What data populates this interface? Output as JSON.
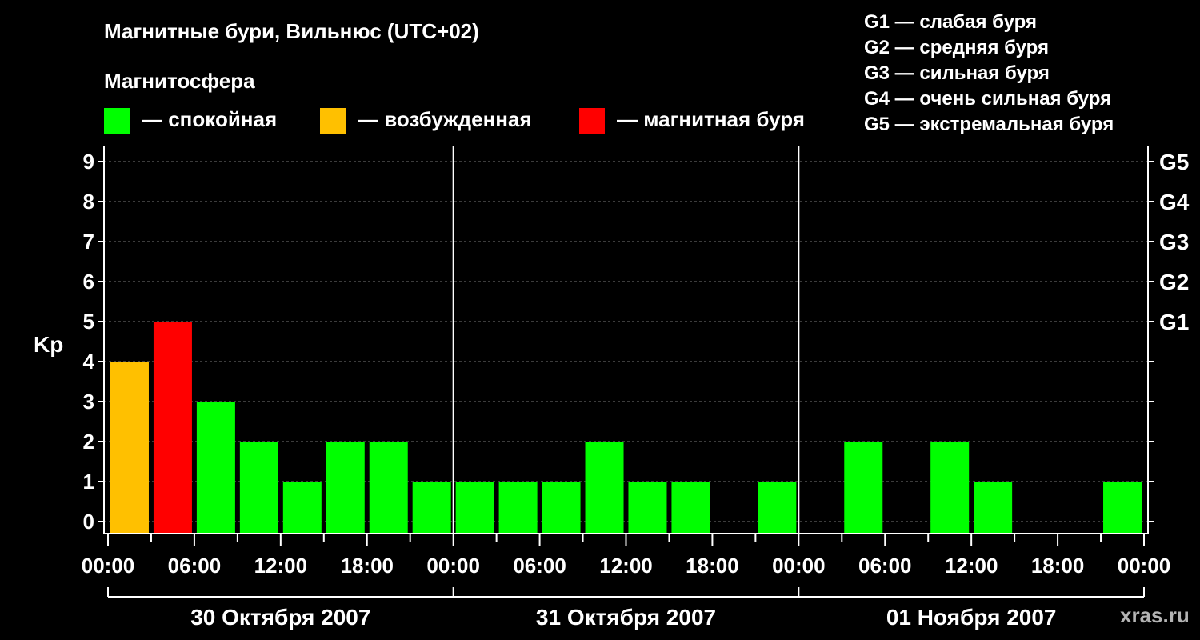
{
  "title": "Магнитные бури, Вильнюс (UTC+02)",
  "subtitle": "Магнитосфера",
  "legend": [
    {
      "label": "— спокойная",
      "color": "#00ff00"
    },
    {
      "label": "— возбужденная",
      "color": "#ffc000"
    },
    {
      "label": "— магнитная буря",
      "color": "#ff0000"
    }
  ],
  "g_legend": [
    "G1 — слабая буря",
    "G2 — средняя буря",
    "G3 — сильная буря",
    "G4 — очень сильная буря",
    "G5 — экстремальная буря"
  ],
  "watermark": "xras.ru",
  "chart_data": {
    "type": "bar",
    "ylabel": "Kp",
    "ylim": [
      0,
      9
    ],
    "yticks": [
      "0",
      "1",
      "2",
      "3",
      "4",
      "5",
      "6",
      "7",
      "8",
      "9"
    ],
    "right_ticks": [
      {
        "value": 5,
        "label": "G1"
      },
      {
        "value": 6,
        "label": "G2"
      },
      {
        "value": 7,
        "label": "G3"
      },
      {
        "value": 8,
        "label": "G4"
      },
      {
        "value": 9,
        "label": "G5"
      }
    ],
    "xtick_labels": [
      "00:00",
      "06:00",
      "12:00",
      "18:00",
      "00:00",
      "06:00",
      "12:00",
      "18:00",
      "00:00",
      "06:00",
      "12:00",
      "18:00",
      "00:00"
    ],
    "days": [
      "30 Октября 2007",
      "31 Октября 2007",
      "01 Ноября 2007"
    ],
    "interval_hours": 3,
    "grid": "dashed horizontal",
    "colors": {
      "quiet": "#00ff00",
      "active": "#ffc000",
      "storm": "#ff0000"
    },
    "values": [
      4,
      5,
      3,
      2,
      1,
      2,
      2,
      1,
      1,
      1,
      1,
      2,
      1,
      1,
      0,
      1,
      0,
      2,
      0,
      2,
      1,
      0,
      0,
      1
    ]
  }
}
